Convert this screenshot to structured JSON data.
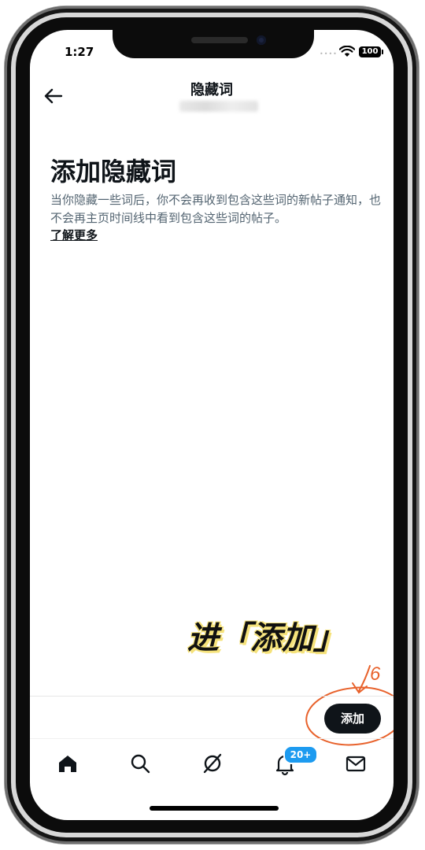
{
  "status_bar": {
    "time": "1:27",
    "battery": "100",
    "signal_dots": "••••"
  },
  "header": {
    "title": "隐藏词",
    "back_icon": "arrow-left-icon"
  },
  "content": {
    "heading": "添加隐藏词",
    "description": "当你隐藏一些词后，你不会再收到包含这些词的新帖子通知，也不会再主页时间线中看到包含这些词的帖子。",
    "learn_more": "了解更多"
  },
  "actions": {
    "add_label": "添加"
  },
  "annotation": {
    "caption": "进「添加」",
    "step_number": "6",
    "color": "#e8622c"
  },
  "tab_bar": {
    "items": [
      "home-icon",
      "search-icon",
      "grok-icon",
      "notifications-icon",
      "messages-icon"
    ],
    "notifications_badge": "20+"
  },
  "colors": {
    "primary_text": "#0f1419",
    "secondary_text": "#536471",
    "accent": "#1d9bf0",
    "button": "#0f1419",
    "caption_highlight": "#f5e27a"
  }
}
